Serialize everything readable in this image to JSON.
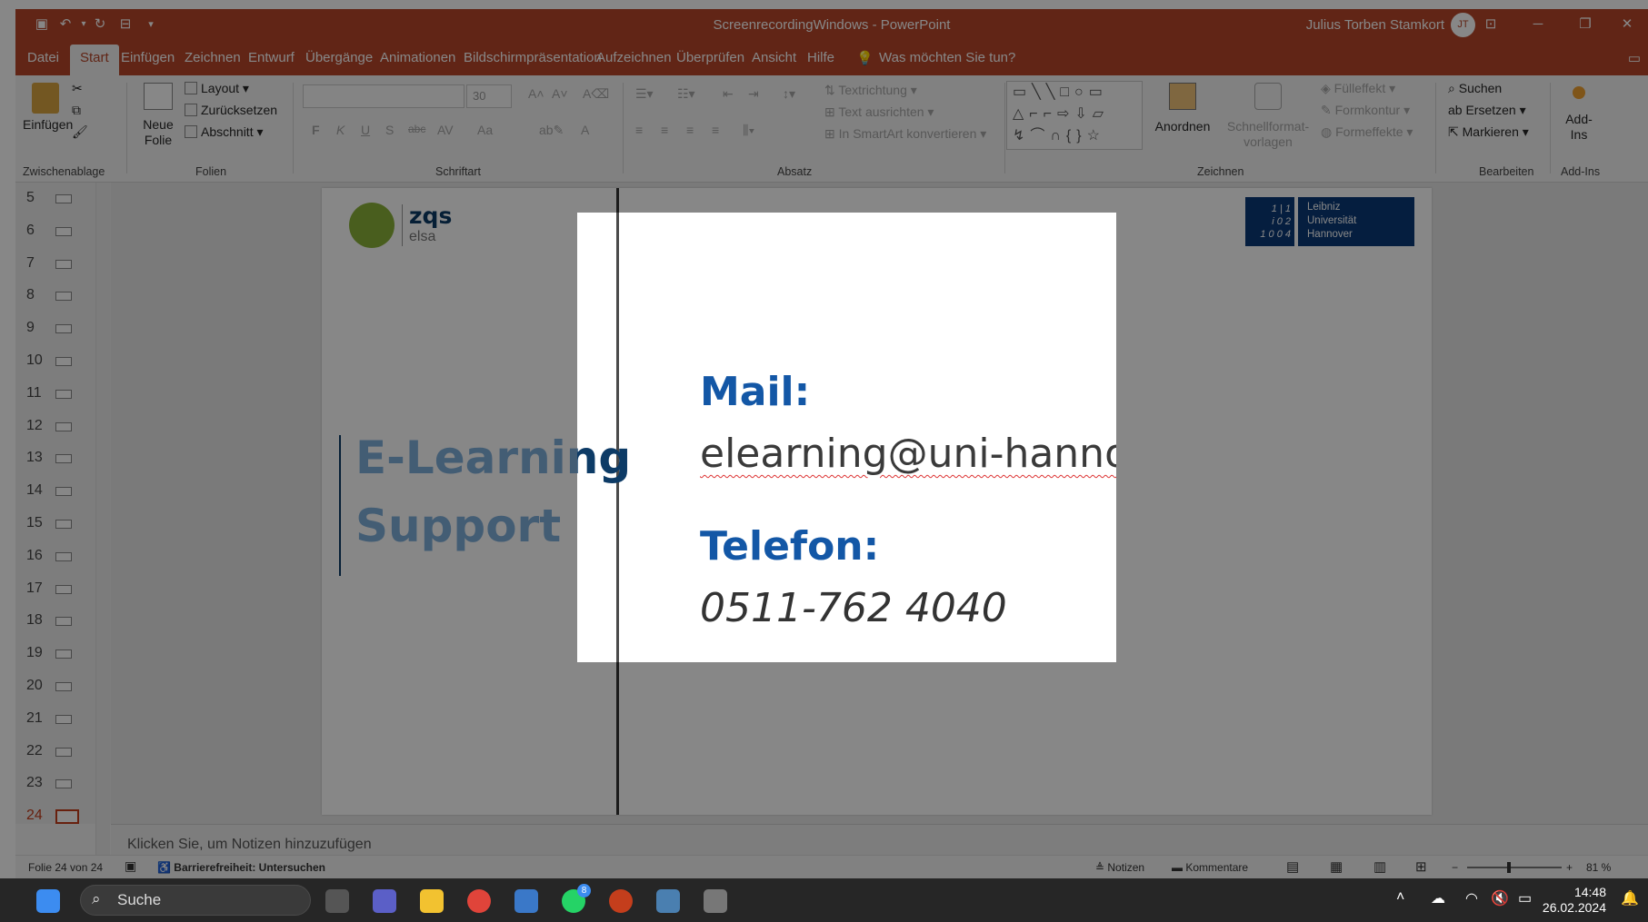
{
  "window": {
    "title": "ScreenrecordingWindows - PowerPoint",
    "user": "Julius Torben Stamkort",
    "initials": "JT"
  },
  "menu": {
    "items": [
      "Datei",
      "Start",
      "Einfügen",
      "Zeichnen",
      "Entwurf",
      "Übergänge",
      "Animationen",
      "Bildschirmpräsentation",
      "Aufzeichnen",
      "Überprüfen",
      "Ansicht",
      "Hilfe"
    ],
    "active": "Start",
    "tell_me": "Was möchten Sie tun?"
  },
  "ribbon": {
    "clipboard": {
      "paste": "Einfügen",
      "group": "Zwischenablage"
    },
    "slides": {
      "new_slide_1": "Neue",
      "new_slide_2": "Folie",
      "layout": "Layout",
      "reset": "Zurücksetzen",
      "section": "Abschnitt",
      "group": "Folien"
    },
    "font": {
      "size": "30",
      "bold": "F",
      "italic": "K",
      "underline": "U",
      "shadow": "S",
      "strike": "abc",
      "spacing": "AV",
      "case": "Aa",
      "color": "A",
      "group": "Schriftart"
    },
    "paragraph": {
      "text_direction": "Textrichtung",
      "align_text": "Text ausrichten",
      "smartart": "In SmartArt konvertieren",
      "group": "Absatz"
    },
    "drawing": {
      "arrange": "Anordnen",
      "quick_styles_1": "Schnellformat-",
      "quick_styles_2": "vorlagen",
      "fill": "Fülleffekt",
      "outline": "Formkontur",
      "effects": "Formeffekte",
      "group": "Zeichnen"
    },
    "editing": {
      "find": "Suchen",
      "replace": "Ersetzen",
      "select": "Markieren",
      "group": "Bearbeiten"
    },
    "addins": {
      "label_1": "Add-",
      "label_2": "Ins",
      "group": "Add-Ins"
    }
  },
  "thumbnails": {
    "numbers": [
      "5",
      "6",
      "7",
      "8",
      "9",
      "10",
      "11",
      "12",
      "13",
      "14",
      "15",
      "16",
      "17",
      "18",
      "19",
      "20",
      "21",
      "22",
      "23",
      "24"
    ],
    "selected": "24"
  },
  "slide": {
    "logo_left_1": "zqs",
    "logo_left_2": "elsa",
    "logo_right_digits": "1 | 1\ni 0 2\n1 0 0 4",
    "logo_right_1": "Leibniz",
    "logo_right_2": "Universität",
    "logo_right_3": "Hannover",
    "title_1": "E-Learning",
    "title_2": "Support",
    "mail_label": "Mail:",
    "mail_value": "elearning@uni-hannover.de",
    "phone_label": "Telefon:",
    "phone_value": "0511-762 4040"
  },
  "notes": {
    "placeholder": "Klicken Sie, um Notizen hinzuzufügen"
  },
  "status": {
    "slide_counter": "Folie 24 von 24",
    "accessibility": "Barrierefreiheit: Untersuchen",
    "notes": "Notizen",
    "comments": "Kommentare",
    "zoom": "81 %"
  },
  "taskbar": {
    "search": "Suche",
    "time": "14:48",
    "date": "26.02.2024",
    "whatsapp_badge": "8"
  },
  "colors": {
    "accent": "#b7472a",
    "title_blue": "#0d3b66",
    "label_blue": "#1357a6"
  }
}
